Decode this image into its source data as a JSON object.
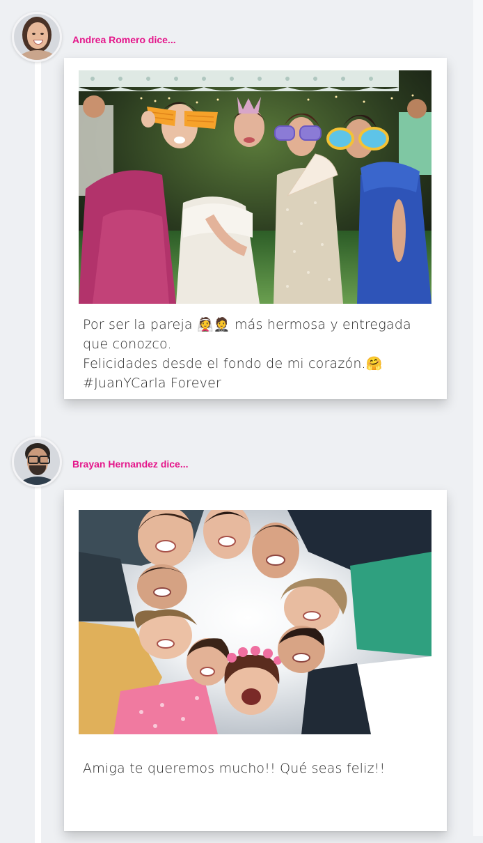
{
  "posts": [
    {
      "author": "Andrea Romero dice...",
      "caption_lines": [
        "Por ser la pareja 👰🤵 más hermosa y entregada",
        "que conozco.",
        "Felicidades desde el fondo de mi corazón.🤗",
        "#JuanYCarla Forever"
      ]
    },
    {
      "author": "Brayan Hernandez dice...",
      "caption_lines": [
        "Amiga te queremos mucho!! Qué seas feliz!!"
      ]
    }
  ],
  "colors": {
    "author": "#e4158a",
    "background": "#eef0f3",
    "card": "#ffffff"
  }
}
